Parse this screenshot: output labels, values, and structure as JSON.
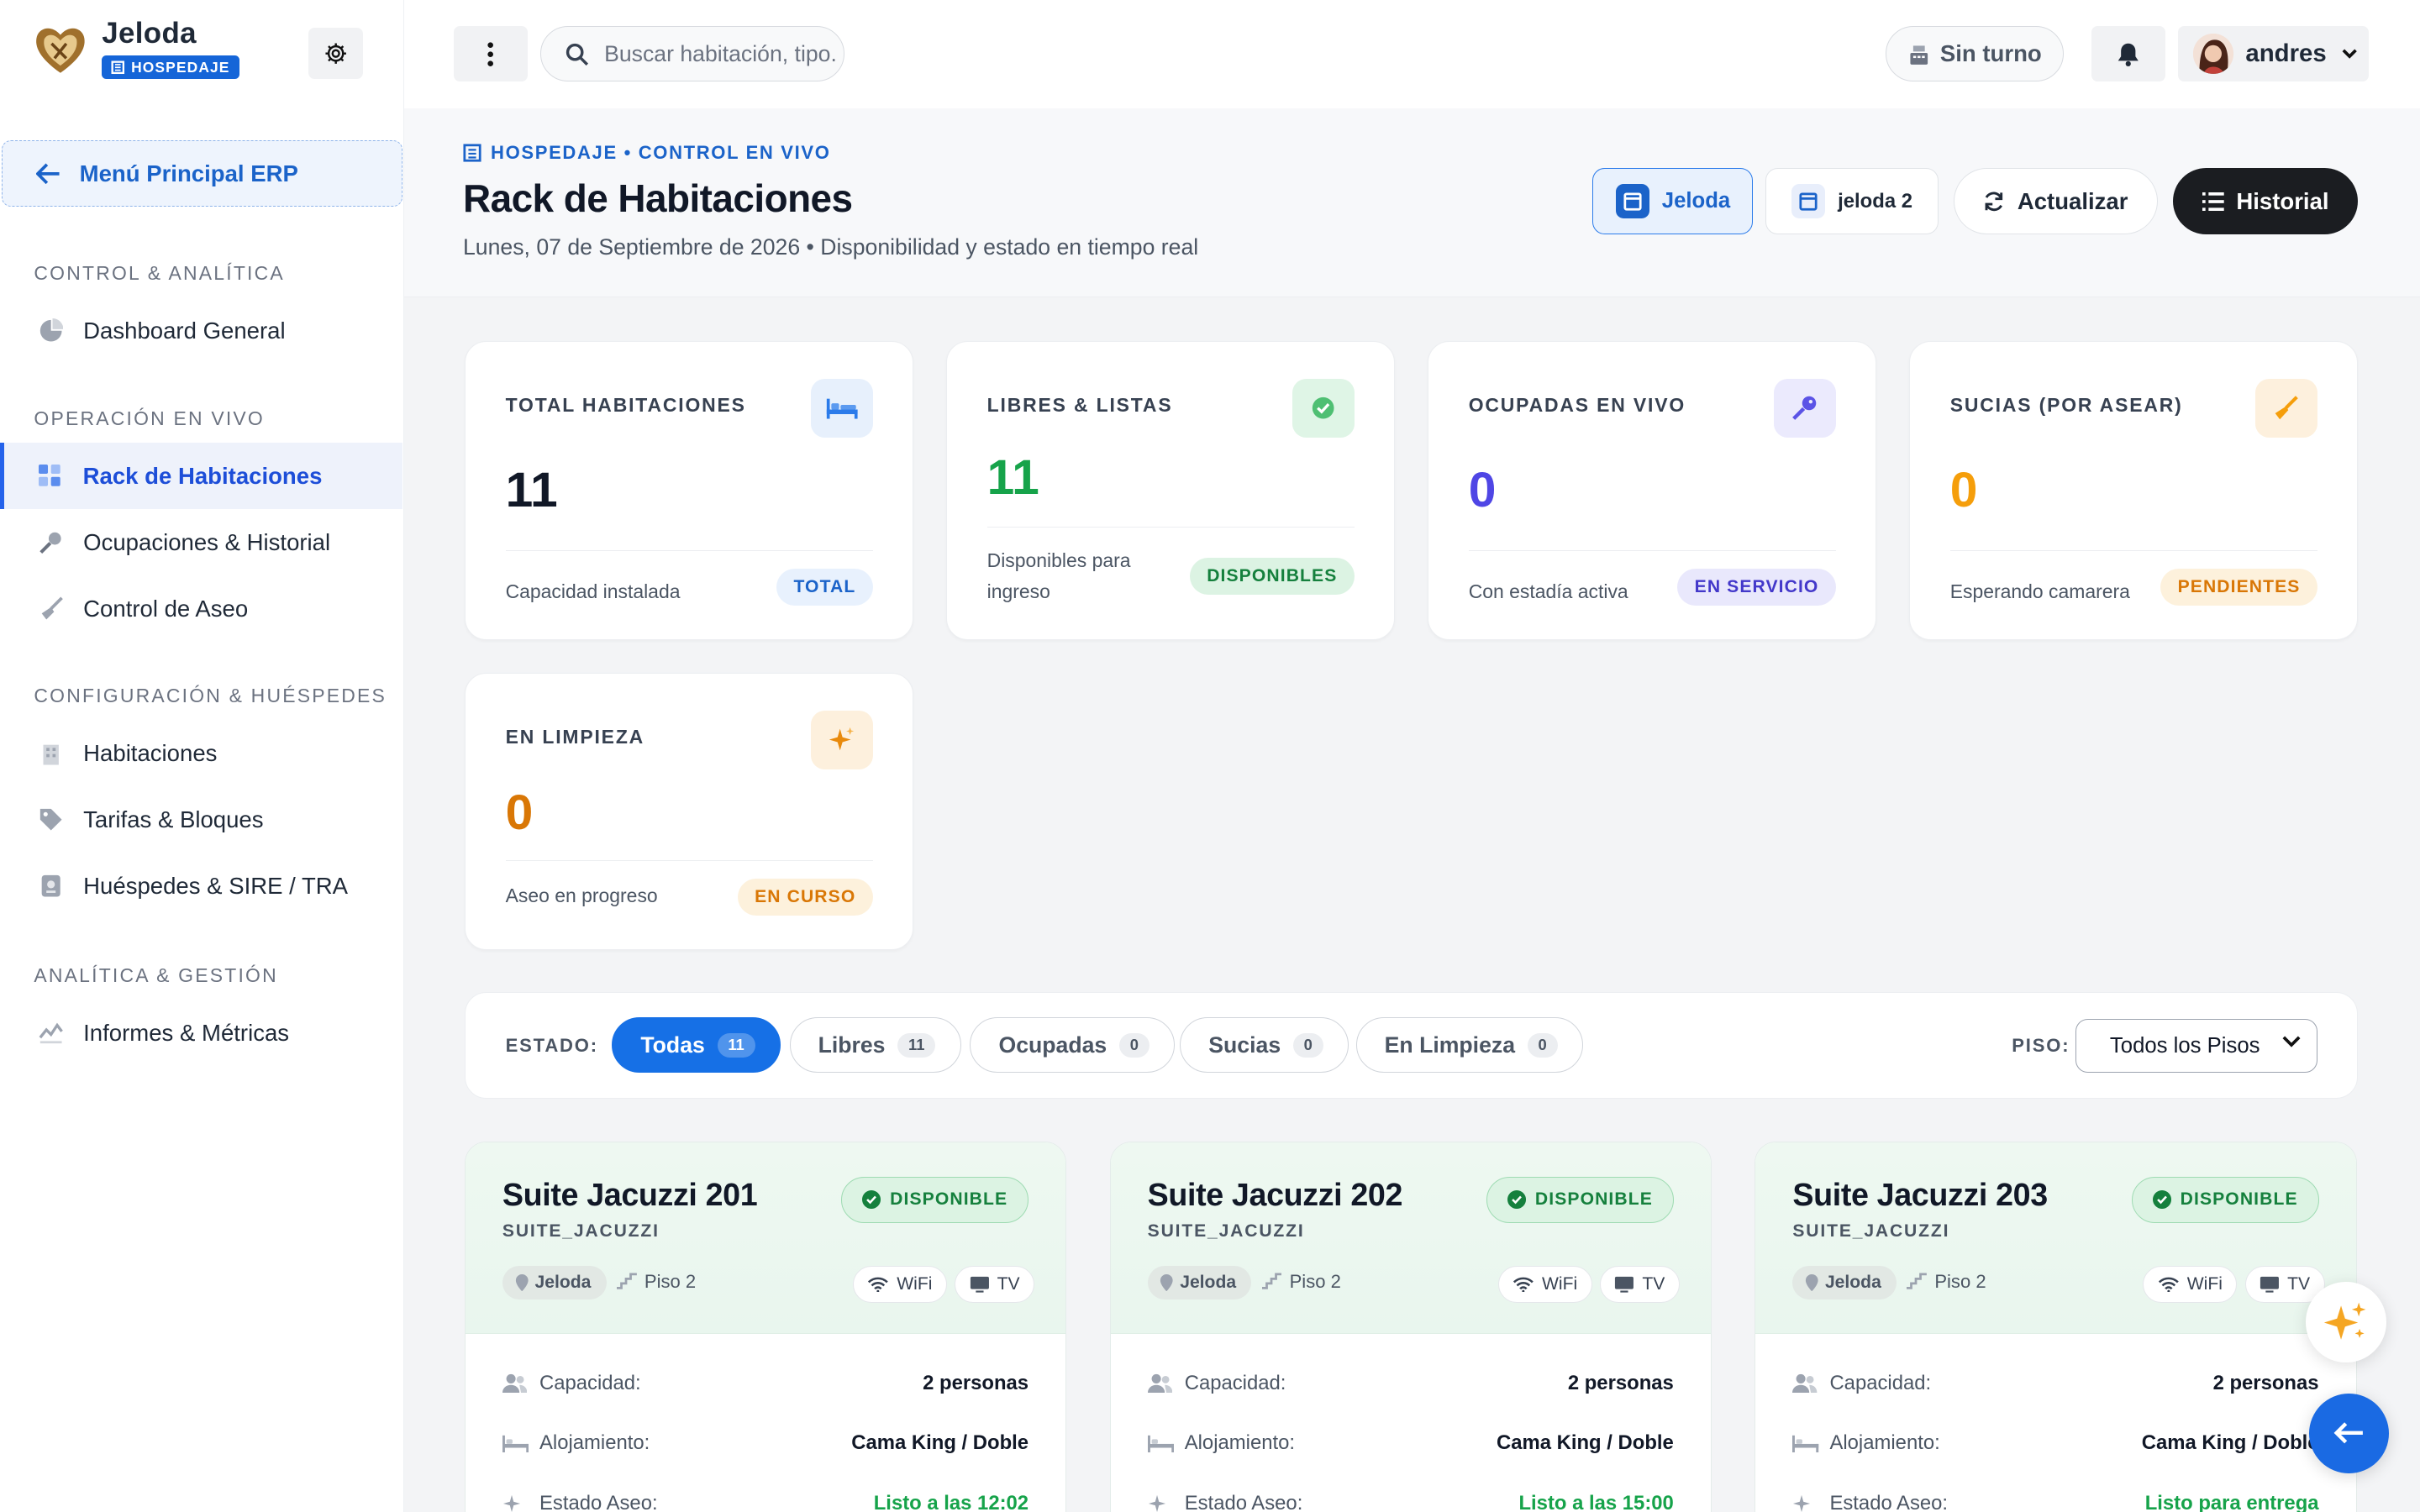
{
  "brand": {
    "name": "Jeloda",
    "badge": "HOSPEDAJE"
  },
  "sidebar": {
    "erp_button": "Menú Principal ERP",
    "sections": [
      {
        "title": "CONTROL & ANALÍTICA",
        "items": [
          {
            "label": "Dashboard General",
            "icon": "pie-chart-icon"
          }
        ]
      },
      {
        "title": "OPERACIÓN EN VIVO",
        "items": [
          {
            "label": "Rack de Habitaciones",
            "icon": "grid-icon",
            "active": true
          },
          {
            "label": "Ocupaciones & Historial",
            "icon": "key-icon"
          },
          {
            "label": "Control de Aseo",
            "icon": "broom-icon"
          }
        ]
      },
      {
        "title": "CONFIGURACIÓN & HUÉSPEDES",
        "items": [
          {
            "label": "Habitaciones",
            "icon": "building-icon"
          },
          {
            "label": "Tarifas & Bloques",
            "icon": "tag-icon"
          },
          {
            "label": "Huéspedes & SIRE / TRA",
            "icon": "passport-icon"
          }
        ]
      },
      {
        "title": "ANALÍTICA & GESTIÓN",
        "items": [
          {
            "label": "Informes & Métricas",
            "icon": "chart-line-icon"
          }
        ]
      }
    ]
  },
  "topbar": {
    "search_placeholder": "Buscar habitación, tipo...",
    "shift_label": "Sin turno",
    "user_name": "andres"
  },
  "header": {
    "kicker": "HOSPEDAJE • CONTROL EN VIVO",
    "title": "Rack de Habitaciones",
    "subtitle": "Lunes, 07 de Septiembre de 2026 • Disponibilidad y estado en tiempo real",
    "buttons": {
      "property1": "Jeloda",
      "property2": "jeloda 2",
      "refresh": "Actualizar",
      "history": "Historial"
    }
  },
  "stats": [
    {
      "label": "TOTAL HABITACIONES",
      "value": "11",
      "foot": "Capacidad instalada",
      "tag": "TOTAL",
      "color": "#111827",
      "icon": "bed-icon"
    },
    {
      "label": "LIBRES & LISTAS",
      "value": "11",
      "foot": "Disponibles para ingreso",
      "tag": "DISPONIBLES",
      "color": "#16a34a",
      "icon": "check-circle-icon"
    },
    {
      "label": "OCUPADAS EN VIVO",
      "value": "0",
      "foot": "Con estadía activa",
      "tag": "EN SERVICIO",
      "color": "#4f46e5",
      "icon": "key-icon"
    },
    {
      "label": "SUCIAS (POR ASEAR)",
      "value": "0",
      "foot": "Esperando camarera",
      "tag": "PENDIENTES",
      "color": "#f59e0b",
      "icon": "broom-icon"
    },
    {
      "label": "EN LIMPIEZA",
      "value": "0",
      "foot": "Aseo en progreso",
      "tag": "EN CURSO",
      "color": "#d97706",
      "icon": "sparkle-icon"
    }
  ],
  "filters": {
    "estado_label": "ESTADO:",
    "chips": [
      {
        "label": "Todas",
        "count": "11",
        "active": true
      },
      {
        "label": "Libres",
        "count": "11"
      },
      {
        "label": "Ocupadas",
        "count": "0"
      },
      {
        "label": "Sucias",
        "count": "0"
      },
      {
        "label": "En Limpieza",
        "count": "0"
      }
    ],
    "piso_label": "PISO:",
    "piso_value": "Todos los Pisos"
  },
  "rooms": [
    {
      "name": "Suite Jacuzzi 201",
      "code": "SUITE_JACUZZI",
      "status": "DISPONIBLE",
      "location": "Jeloda",
      "floor": "Piso 2",
      "amenities": [
        "WiFi",
        "TV"
      ],
      "capacity_label": "Capacidad:",
      "capacity": "2 personas",
      "lodging_label": "Alojamiento:",
      "lodging": "Cama King / Doble",
      "clean_label": "Estado Aseo:",
      "clean": "Listo a las 12:02"
    },
    {
      "name": "Suite Jacuzzi 202",
      "code": "SUITE_JACUZZI",
      "status": "DISPONIBLE",
      "location": "Jeloda",
      "floor": "Piso 2",
      "amenities": [
        "WiFi",
        "TV"
      ],
      "capacity_label": "Capacidad:",
      "capacity": "2 personas",
      "lodging_label": "Alojamiento:",
      "lodging": "Cama King / Doble",
      "clean_label": "Estado Aseo:",
      "clean": "Listo a las 15:00"
    },
    {
      "name": "Suite Jacuzzi 203",
      "code": "SUITE_JACUZZI",
      "status": "DISPONIBLE",
      "location": "Jeloda",
      "floor": "Piso 2",
      "amenities": [
        "WiFi",
        "TV"
      ],
      "capacity_label": "Capacidad:",
      "capacity": "2 personas",
      "lodging_label": "Alojamiento:",
      "lodging": "Cama King / Doble",
      "clean_label": "Estado Aseo:",
      "clean": "Listo para entrega"
    }
  ]
}
